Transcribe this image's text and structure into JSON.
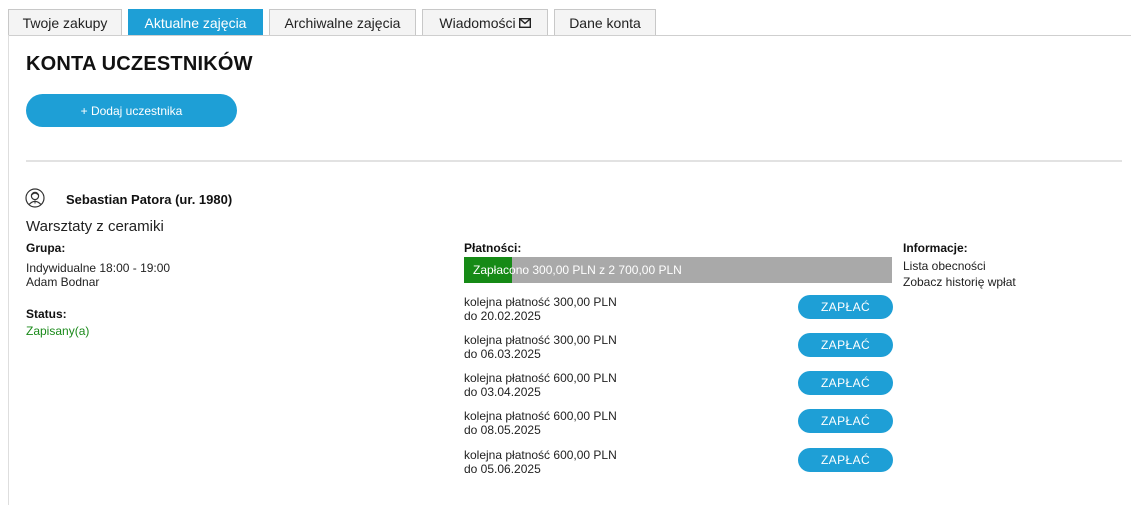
{
  "tabs": [
    {
      "label": "Twoje zakupy",
      "active": false
    },
    {
      "label": "Aktualne zajęcia",
      "active": true
    },
    {
      "label": "Archiwalne zajęcia",
      "active": false
    },
    {
      "label": "Wiadomości",
      "active": false,
      "icon": "envelope-icon"
    },
    {
      "label": "Dane konta",
      "active": false
    }
  ],
  "page": {
    "title": "KONTA UCZESTNIKÓW",
    "add_button_label": "+ Dodaj uczestnika"
  },
  "participant": {
    "avatar_icon": "user-avatar-icon",
    "name": "Sebastian Patora (ur. 1980)",
    "course": "Warsztaty z ceramiki",
    "group_label": "Grupa:",
    "group_schedule": "Indywidualne 18:00 - 19:00",
    "instructor": "Adam Bodnar",
    "status_label": "Status:",
    "status_value": "Zapisany(a)",
    "status_color": "#1a8a1a"
  },
  "payments": {
    "label": "Płatności:",
    "progress_text": "Zapłacono 300,00 PLN z 2 700,00 PLN",
    "paid": 300,
    "total": 2700,
    "progress_fraction": 0.111,
    "pay_button_label": "ZAPŁAĆ",
    "items": [
      {
        "line1": "kolejna płatność 300,00 PLN",
        "line2": "do 20.02.2025"
      },
      {
        "line1": "kolejna płatność 300,00 PLN",
        "line2": "do 06.03.2025"
      },
      {
        "line1": "kolejna płatność 600,00 PLN",
        "line2": "do 03.04.2025"
      },
      {
        "line1": "kolejna płatność 600,00 PLN",
        "line2": "do 08.05.2025"
      },
      {
        "line1": "kolejna płatność 600,00 PLN",
        "line2": "do 05.06.2025"
      }
    ]
  },
  "info": {
    "label": "Informacje:",
    "links": [
      "Lista obecności",
      "Zobacz historię wpłat"
    ]
  },
  "colors": {
    "accent": "#1e9fd6",
    "progress_fill": "#168a16",
    "progress_bg": "#a9a9a9"
  }
}
